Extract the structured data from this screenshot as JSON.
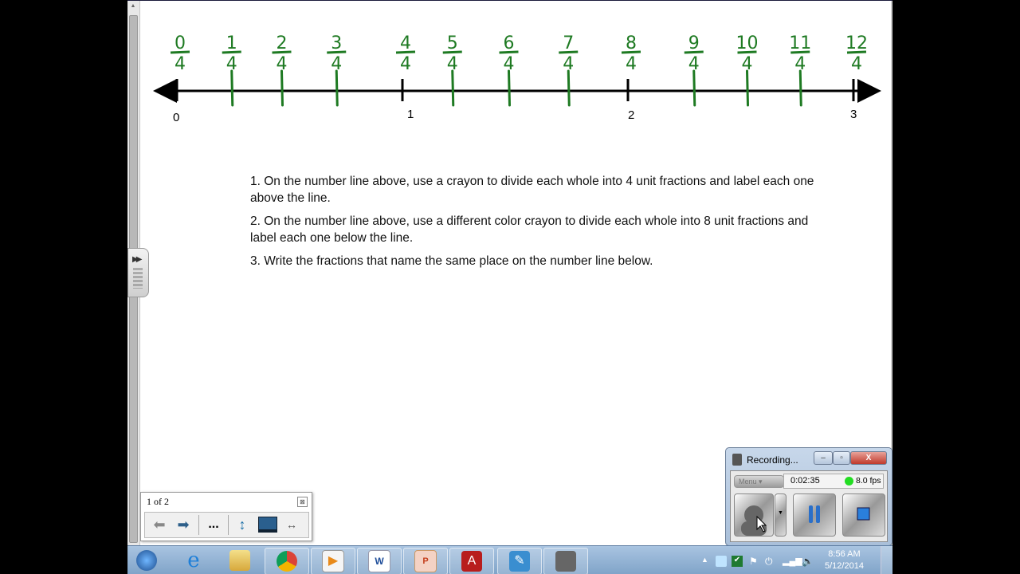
{
  "number_line": {
    "whole_labels": [
      "0",
      "1",
      "2",
      "3"
    ],
    "fourths": [
      {
        "num": "0",
        "den": "4"
      },
      {
        "num": "1",
        "den": "4"
      },
      {
        "num": "2",
        "den": "4"
      },
      {
        "num": "3",
        "den": "4"
      },
      {
        "num": "4",
        "den": "4"
      },
      {
        "num": "5",
        "den": "4"
      },
      {
        "num": "6",
        "den": "4"
      },
      {
        "num": "7",
        "den": "4"
      },
      {
        "num": "8",
        "den": "4"
      },
      {
        "num": "9",
        "den": "4"
      },
      {
        "num": "10",
        "den": "4"
      },
      {
        "num": "11",
        "den": "4"
      },
      {
        "num": "12",
        "den": "4"
      }
    ],
    "ink_color": "#1e7a22"
  },
  "instructions": [
    "1.  On the number line above, use a crayon to divide each whole into 4 unit fractions and label each one above the line.",
    "2.  On the number line above, use a different color crayon to divide each whole into 8 unit fractions and label each one below the line.",
    "3.  Write the fractions that name the same place on the number line below."
  ],
  "pager": {
    "page_label": "1 of 2",
    "close_icon": "close-icon",
    "more_label": "...",
    "buttons": [
      "prev-page",
      "next-page",
      "more",
      "fit-page",
      "display-settings",
      "fit-width"
    ]
  },
  "recorder": {
    "title": "Recording...",
    "menu_label": "Menu",
    "elapsed": "0:02:35",
    "fps": "8.0 fps",
    "status_color": "#22dd22",
    "window_buttons": {
      "minimize": "–",
      "restore": "▫",
      "close": "X"
    }
  },
  "taskbar": {
    "apps": [
      "start",
      "internet-explorer",
      "file-explorer",
      "chrome",
      "media-player",
      "word",
      "powerpoint",
      "acrobat",
      "notebook",
      "camera-recorder"
    ],
    "clock_time": "8:56 AM",
    "clock_date": "5/12/2014"
  }
}
